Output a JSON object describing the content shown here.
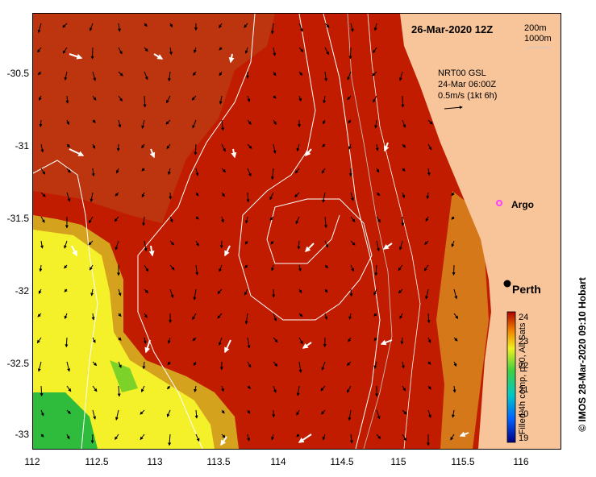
{
  "map": {
    "date_label": "26-Mar-2020 12Z",
    "scale_labels": [
      "200m",
      "1000m"
    ],
    "product_lines": [
      "NRT00 GSL",
      "24-Mar 06:00Z",
      "0.5m/s (1kt 6h)"
    ],
    "argo_label": "Argo",
    "city_label": "Perth",
    "colorbar_title": "Filled 4h comp, p50, All Sats",
    "colorbar_ticks": [
      "24",
      "23",
      "22",
      "21",
      "20",
      "19"
    ],
    "credit": "© IMOS 28-Mar-2020 09:10 Hobart",
    "lon_ticks": [
      "112",
      "112.5",
      "113",
      "113.5",
      "114",
      "114.5",
      "115",
      "115.5",
      "116"
    ],
    "lat_ticks": [
      "-30.5",
      "-31",
      "-31.5",
      "-32",
      "-32.5",
      "-33"
    ],
    "extent": {
      "lon_min": 112,
      "lon_max": 116.3,
      "lat_min": -33.1,
      "lat_max": -30.1
    },
    "sst_range": [
      19,
      24.3
    ],
    "colors": {
      "land": "#f8c499",
      "warm": "#c01a00",
      "mid": "#d5a21e",
      "cool": "#f4f02a",
      "green": "#2fbb3c"
    },
    "argo_position": {
      "lon": 115.8,
      "lat": -31.5
    },
    "perth_position": {
      "lon": 115.86,
      "lat": -31.95
    }
  }
}
